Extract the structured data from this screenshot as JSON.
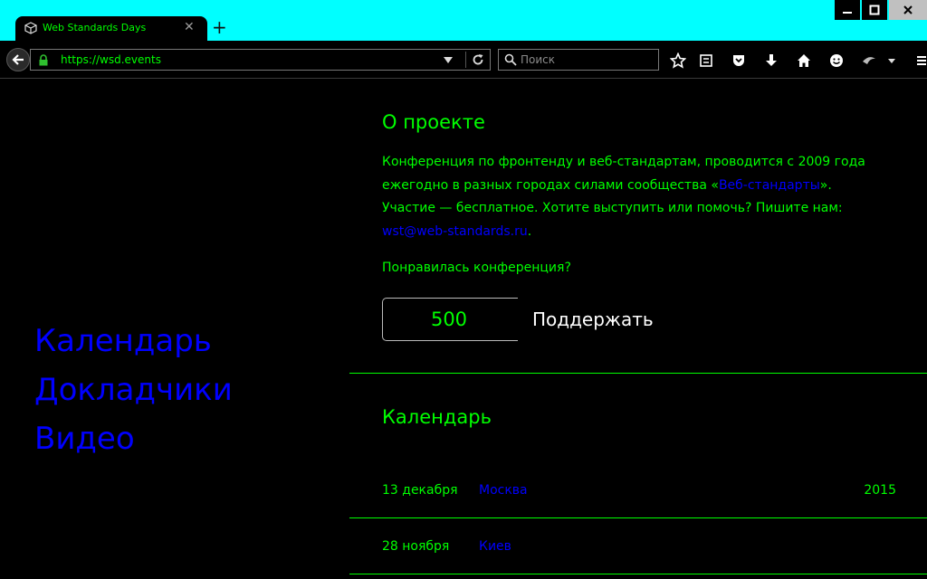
{
  "browser": {
    "tab_title": "Web Standards Days",
    "url": "https://wsd.events",
    "search_placeholder": "Поиск"
  },
  "sidebar": {
    "links": [
      {
        "label": "Календарь"
      },
      {
        "label": "Докладчики"
      },
      {
        "label": "Видео"
      }
    ]
  },
  "about": {
    "heading": "О проекте",
    "line1": "Конференция по фронтенду и веб-стандартам, проводится с 2009 года ежегодно в разных городах силами сообщества «",
    "community_link": "Веб-стандарты",
    "line1_end": "».",
    "line2": "Участие — бесплатное. Хотите выступить или помочь? Пишите нам: ",
    "email_link": "wst@web-standards.ru",
    "line2_end": ".",
    "liked": "Понравилась конференция?",
    "amount": "500",
    "support_label": "Поддержать"
  },
  "calendar": {
    "heading": "Календарь",
    "events": [
      {
        "date": "13 декабря",
        "city": "Москва",
        "year": "2015"
      },
      {
        "date": "28 ноября",
        "city": "Киев",
        "year": ""
      }
    ]
  },
  "colors": {
    "accent_text": "#00ff00",
    "link": "#0000ff",
    "chrome": "#00ffff",
    "background": "#000000"
  }
}
